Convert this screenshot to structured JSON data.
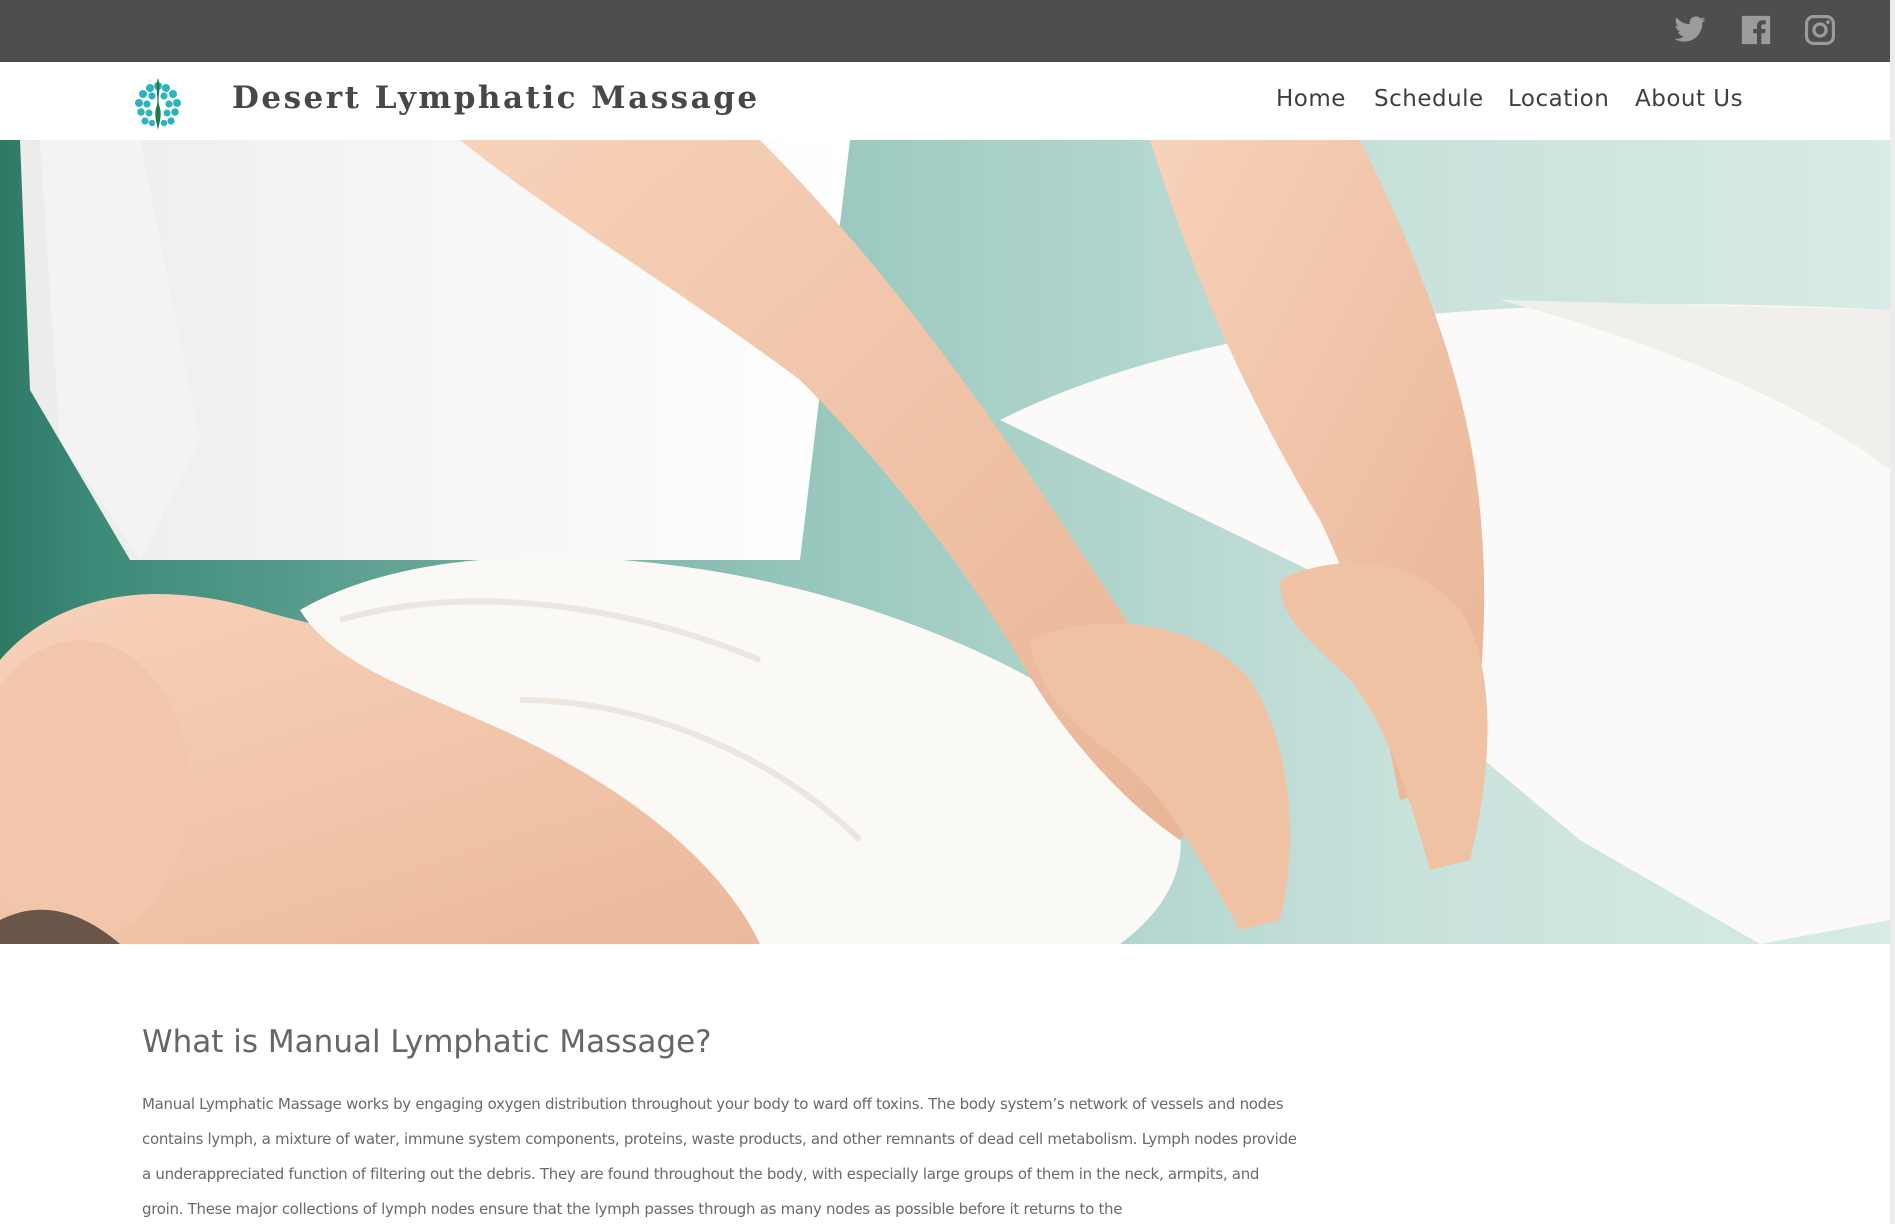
{
  "social": {
    "icons": [
      "twitter-icon",
      "facebook-icon",
      "instagram-icon"
    ],
    "icon_color": "#9b9b9b",
    "bar_color": "#4e4e4e"
  },
  "header": {
    "site_title": "Desert Lymphatic Massage",
    "logo_color": "#2bb3c0",
    "nav": {
      "home": "Home",
      "schedule": "Schedule",
      "location": "Location",
      "about": "About Us"
    }
  },
  "main": {
    "heading": "What is Manual Lymphatic Massage?",
    "paragraph": "Manual Lymphatic Massage works by engaging oxygen distribution throughout your body to ward off toxins. The body system’s network of vessels and nodes contains lymph, a mixture of water, immune system components, proteins, waste products, and other remnants of dead cell metabolism. Lymph nodes provide a underappreciated function of filtering out the debris. They are found throughout the body, with especially large groups of them in the neck, armpits, and groin. These major collections of lymph nodes ensure that the lymph passes through as many nodes as possible before it returns to the"
  }
}
